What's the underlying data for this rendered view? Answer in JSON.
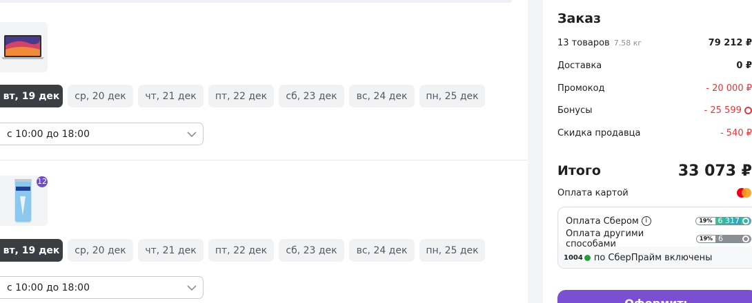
{
  "items": [
    {
      "image": "laptop-icon",
      "dates": [
        {
          "label": "вт, 19 дек",
          "active": true
        },
        {
          "label": "ср, 20 дек",
          "active": false
        },
        {
          "label": "чт, 21 дек",
          "active": false
        },
        {
          "label": "пт, 22 дек",
          "active": false
        },
        {
          "label": "сб, 23 дек",
          "active": false
        },
        {
          "label": "вс, 24 дек",
          "active": false
        },
        {
          "label": "пн, 25 дек",
          "active": false
        }
      ],
      "time_slot": "с 10:00 до 18:00"
    },
    {
      "image": "drink-can-icon",
      "quantity": "12",
      "dates": [
        {
          "label": "вт, 19 дек",
          "active": true
        },
        {
          "label": "ср, 20 дек",
          "active": false
        },
        {
          "label": "чт, 21 дек",
          "active": false
        },
        {
          "label": "пт, 22 дек",
          "active": false
        },
        {
          "label": "сб, 23 дек",
          "active": false
        },
        {
          "label": "вс, 24 дек",
          "active": false
        },
        {
          "label": "пн, 25 дек",
          "active": false
        }
      ],
      "time_slot": "с 10:00 до 18:00"
    }
  ],
  "order": {
    "title": "Заказ",
    "items_label": "13 товаров",
    "weight": "7.58 кг",
    "items_value": "79 212 ₽",
    "delivery_label": "Доставка",
    "delivery_value": "0 ₽",
    "promo_label": "Промокод",
    "promo_value": "- 20 000 ₽",
    "bonus_label": "Бонусы",
    "bonus_value": "- 25 599",
    "seller_discount_label": "Скидка продавца",
    "seller_discount_value": "- 540 ₽",
    "total_label": "Итого",
    "total_value": "33 073 ₽",
    "card_payment_label": "Оплата картой",
    "sber_payment_label": "Оплата Сбером",
    "sber_bonus_percent": "19%",
    "sber_bonus_amount": "6 317",
    "other_payment_label": "Оплата другими способами",
    "other_bonus_percent": "19%",
    "other_bonus_amount": "6 317",
    "prime_points": "1004",
    "prime_text": "по СберПрайм включены",
    "checkout_label": "Оформить"
  },
  "colors": {
    "accent": "#7b4fd1",
    "negative": "#e0363a",
    "active_chip": "#3a3d42",
    "sber_green": "#21a038"
  }
}
